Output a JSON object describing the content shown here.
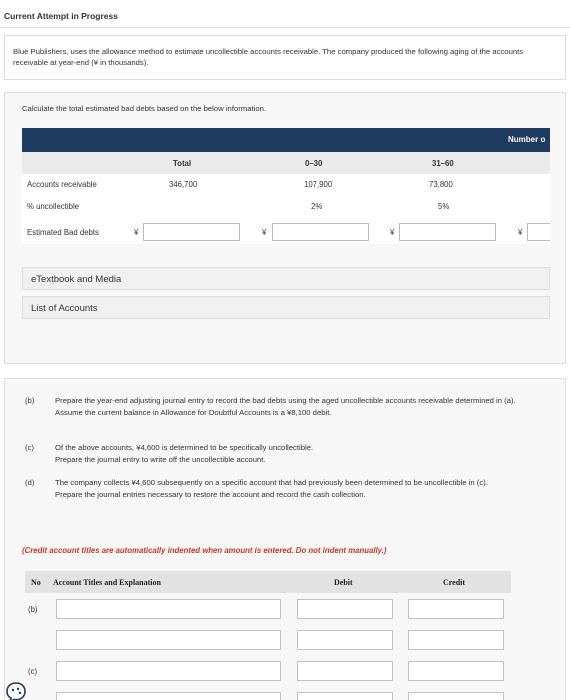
{
  "attempt": {
    "status": "Current Attempt in Progress"
  },
  "problem": {
    "text": "Blue Publishers, uses the allowance method to estimate uncollectible accounts receivable. The company produced the following aging of the accounts receivable at year-end (¥ in thousands)."
  },
  "part_a": {
    "instruction": "Calculate the total estimated bad debts based on the below information.",
    "header_number_label": "Number o",
    "columns": [
      "Total",
      "0–30",
      "31–60"
    ],
    "rows": {
      "accounts_receivable": {
        "label": "Accounts receivable",
        "values": [
          "346,700",
          "107,900",
          "73,800"
        ]
      },
      "pct_uncollectible": {
        "label": "% uncollectible",
        "values": [
          "",
          "2%",
          "5%"
        ]
      },
      "estimated_bad_debts": {
        "label": "Estimated Bad debts",
        "currency": "¥",
        "values": [
          "",
          "",
          "",
          ""
        ]
      }
    },
    "etextbook_label": "eTextbook and Media",
    "accounts_list_label": "List of Accounts"
  },
  "part_b_to_d": {
    "items": [
      {
        "letter": "(b)",
        "text": "Prepare the year-end adjusting journal entry to record the bad debts using the aged uncollectible accounts receivable determined in (a).",
        "text2": "Assume the current balance in Allowance for Doubtful Accounts is a ¥8,100 debit."
      },
      {
        "letter": "(c)",
        "text": "Of the above accounts, ¥4,600 is determined to be specifically uncollectible.",
        "text2": "Prepare the journal entry to write off the uncollectible account."
      },
      {
        "letter": "(d)",
        "text": "The company collects ¥4,600 subsequently on a specific account that had previously been determined to be uncollectible in (c).",
        "text2": "Prepare the journal entries necessary to restore the account and record the cash collection."
      }
    ],
    "indent_note": "(Credit account titles are automatically indented when amount is entered. Do not indent manually.)"
  },
  "journal": {
    "headers": {
      "no": "No",
      "account": "Account Titles and Explanation",
      "debit": "Debit",
      "credit": "Credit"
    },
    "refs": [
      "(b)",
      "(c)"
    ],
    "account_values": [
      "",
      "",
      "",
      ""
    ],
    "debit_values": [
      "",
      "",
      "",
      ""
    ],
    "credit_values": [
      "",
      "",
      "",
      ""
    ]
  },
  "colors": {
    "header_navy": "#1f3a5f",
    "note_red": "#c0392b"
  },
  "icons": {
    "help": "help-bubble-icon"
  }
}
